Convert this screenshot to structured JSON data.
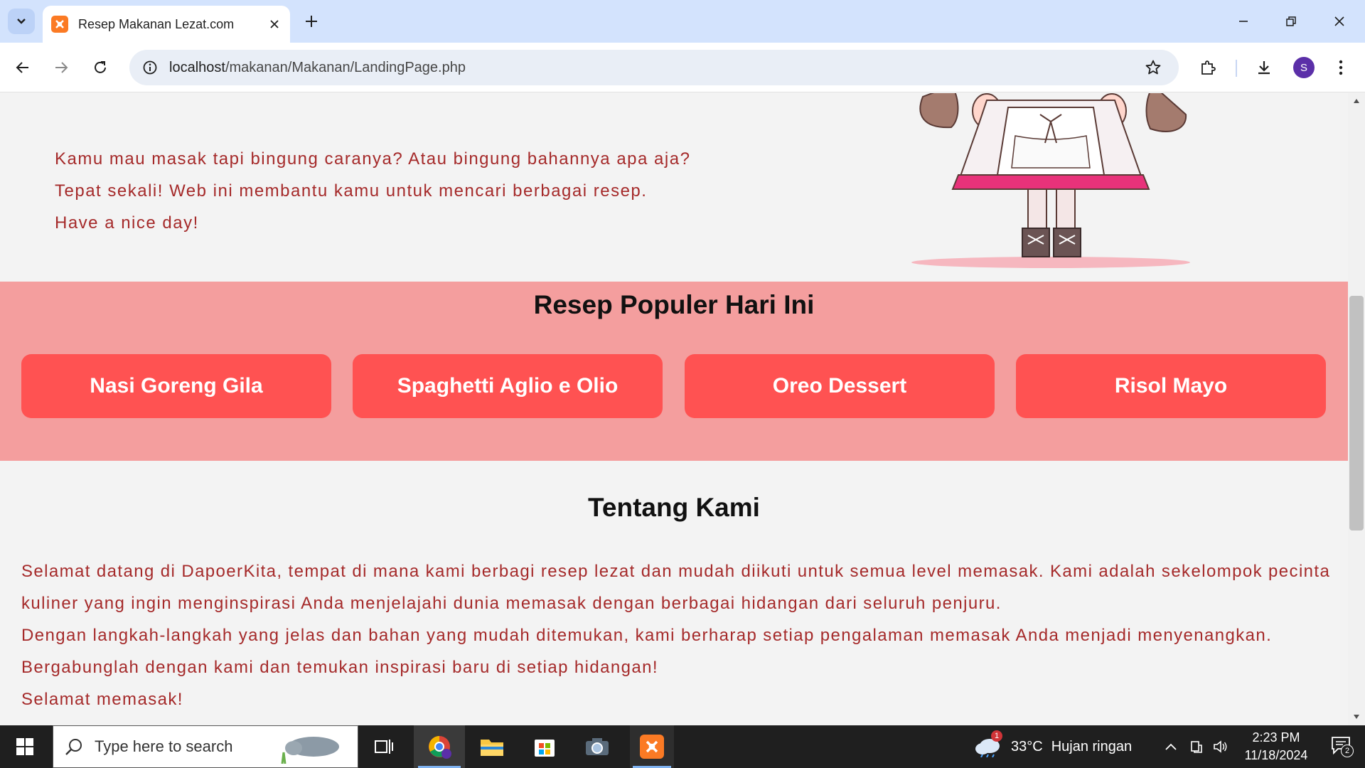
{
  "browser": {
    "tab_title": "Resep Makanan Lezat.com",
    "url_host": "localhost",
    "url_path": "/makanan/Makanan/LandingPage.php",
    "profile_initial": "S"
  },
  "intro": {
    "line1": "Kamu mau masak tapi bingung caranya? Atau bingung bahannya apa aja?",
    "line2": "Tepat sekali! Web ini membantu kamu untuk mencari berbagai resep.",
    "line3": "Have a nice day!"
  },
  "popular": {
    "heading": "Resep Populer Hari Ini",
    "recipes": [
      "Nasi Goreng Gila",
      "Spaghetti Aglio e Olio",
      "Oreo Dessert",
      "Risol Mayo"
    ]
  },
  "about": {
    "heading": "Tentang Kami",
    "p1": "Selamat datang di DapoerKita, tempat di mana kami berbagi resep lezat dan mudah diikuti untuk semua level memasak. Kami adalah sekelompok pecinta kuliner yang ingin menginspirasi Anda menjelajahi dunia memasak dengan berbagai hidangan dari seluruh penjuru.",
    "p2": "Dengan langkah-langkah yang jelas dan bahan yang mudah ditemukan, kami berharap setiap pengalaman memasak Anda menjadi menyenangkan.",
    "p3": "Bergabunglah dengan kami dan temukan inspirasi baru di setiap hidangan!",
    "p4": "Selamat memasak!"
  },
  "taskbar": {
    "search_placeholder": "Type here to search",
    "weather_temp": "33°C",
    "weather_desc": "Hujan ringan",
    "weather_badge": "1",
    "time": "2:23 PM",
    "date": "11/18/2024",
    "notification_count": "2"
  },
  "colors": {
    "accent_text": "#a52a2a",
    "popular_bg": "#f49e9e",
    "recipe_button": "#ff5252",
    "tab_strip": "#d3e3fd"
  }
}
